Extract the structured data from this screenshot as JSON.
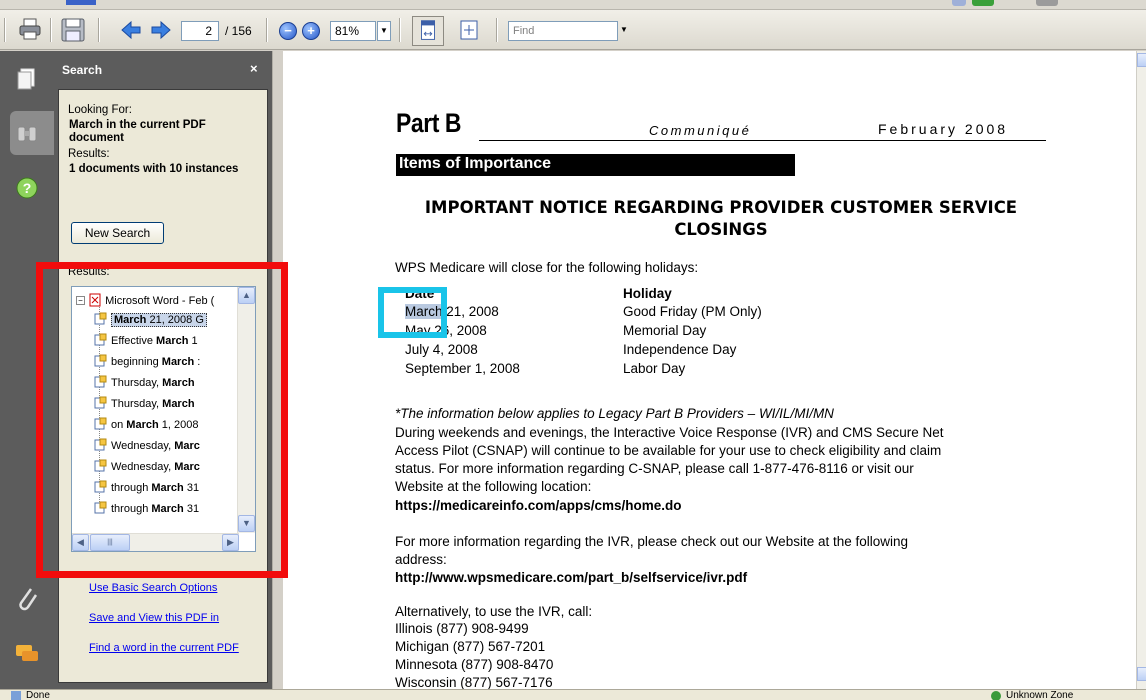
{
  "toolbar": {
    "page_current": "2",
    "page_total": "/ 156",
    "zoom_value": "81%",
    "find_placeholder": "Find"
  },
  "search_panel": {
    "title": "Search",
    "close_glyph": "×",
    "looking_for_label": "Looking For:",
    "looking_for_value": "March in the current PDF document",
    "results_label": "Results:",
    "results_value": "1 documents with 10 instances",
    "new_search_button": "New Search",
    "results_list_label": "Results:",
    "tree_root": "Microsoft Word - Feb (",
    "tree_items": [
      {
        "pre": "",
        "bold": "March",
        "post": " 21, 2008 G"
      },
      {
        "pre": "Effective ",
        "bold": "March",
        "post": " 1"
      },
      {
        "pre": "beginning ",
        "bold": "March",
        "post": " :"
      },
      {
        "pre": "Thursday, ",
        "bold": "March",
        "post": ""
      },
      {
        "pre": "Thursday, ",
        "bold": "March",
        "post": ""
      },
      {
        "pre": "on ",
        "bold": "March",
        "post": " 1, 2008"
      },
      {
        "pre": "Wednesday, ",
        "bold": "Marc",
        "post": ""
      },
      {
        "pre": "Wednesday, ",
        "bold": "Marc",
        "post": ""
      },
      {
        "pre": "through ",
        "bold": "March",
        "post": " 31"
      },
      {
        "pre": "through ",
        "bold": "March",
        "post": " 31"
      }
    ],
    "links": {
      "basic_options": "Use Basic Search Options",
      "save_view": "Save and View this PDF in",
      "find_word": "Find a word in the current PDF"
    }
  },
  "document": {
    "part_b": "Part B",
    "communique": "Communiqué",
    "date": "February 2008",
    "items_heading": "Items of Importance",
    "notice_title": "IMPORTANT NOTICE REGARDING PROVIDER CUSTOMER SERVICE CLOSINGS",
    "intro": "WPS Medicare will close for the following holidays:",
    "col_date": "Date",
    "col_holiday": "Holiday",
    "holidays": [
      {
        "date_hl": "March",
        "date_rest": " 21, 2008",
        "holiday": "Good Friday (PM Only)"
      },
      {
        "date_hl": "",
        "date_rest": "May 26, 2008",
        "holiday": "Memorial Day"
      },
      {
        "date_hl": "",
        "date_rest": "July 4, 2008",
        "holiday": "Independence Day"
      },
      {
        "date_hl": "",
        "date_rest": "September 1, 2008",
        "holiday": "Labor Day"
      }
    ],
    "legacy_note": "*The information below applies to Legacy Part B Providers – WI/IL/MI/MN",
    "para1": [
      "During weekends and evenings, the Interactive Voice Response (IVR) and CMS Secure Net",
      "Access Pilot (CSNAP) will continue to be available for your use to check eligibility and claim",
      "status.  For more information regarding C-SNAP, please call 1-877-476-8116 or visit our",
      "Website at the following location:"
    ],
    "url1": "https://medicareinfo.com/apps/cms/home.do",
    "para2": [
      "For more information regarding the IVR, please check out our Website at the following",
      "address:"
    ],
    "url2": "http://www.wpsmedicare.com/part_b/selfservice/ivr.pdf",
    "alt_intro": "Alternatively, to use the IVR, call:",
    "phones": [
      "Illinois (877) 908-9499",
      "Michigan (877) 567-7201",
      "Minnesota (877) 908-8470",
      "Wisconsin (877) 567-7176"
    ]
  },
  "status": {
    "left": "Done",
    "right": "Unknown Zone"
  }
}
